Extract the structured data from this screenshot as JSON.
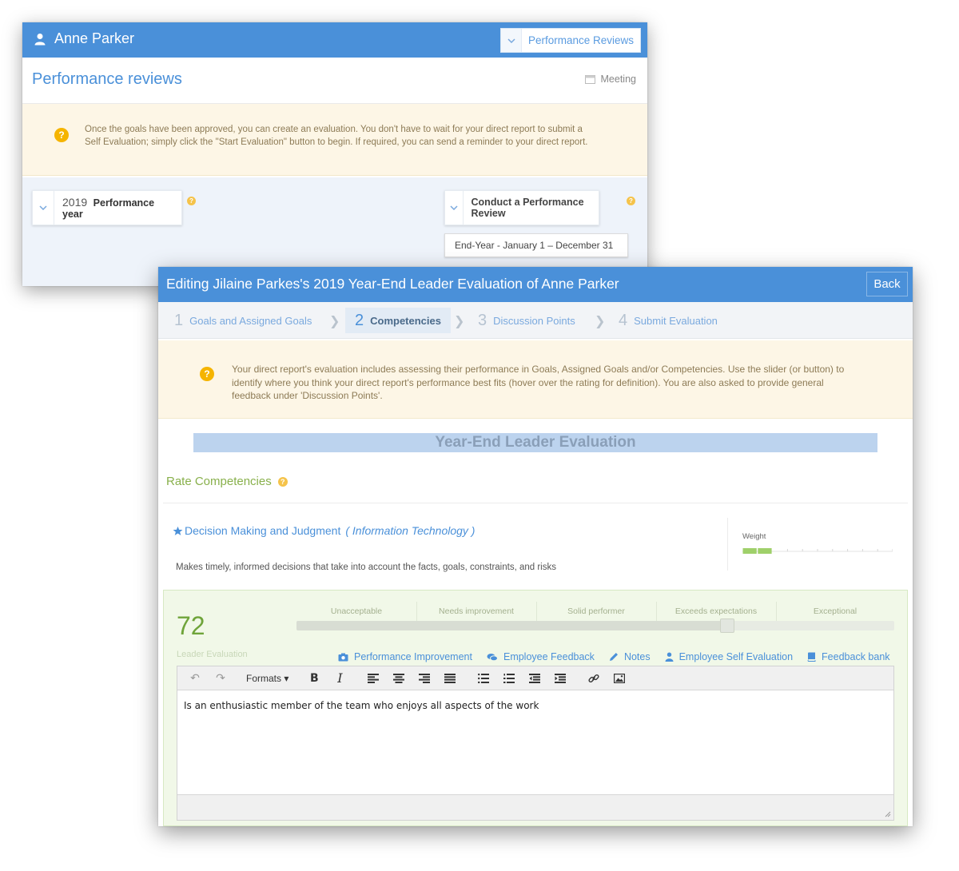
{
  "back_window": {
    "user_name": "Anne Parker",
    "module_select": "Performance Reviews",
    "title": "Performance reviews",
    "meeting_label": "Meeting",
    "alert_text": "Once the goals have been approved, you can create an evaluation. You don't have to wait for your direct report to submit a Self Evaluation; simply click the \"Start Evaluation\" button to begin. If required, you can send a reminder to your direct report.",
    "year_value": "2019",
    "year_label": "Performance year",
    "conduct_label": "Conduct a Performance Review",
    "period": "End-Year - January 1 – December 31"
  },
  "front_window": {
    "title": "Editing Jilaine Parkes's 2019 Year-End Leader Evaluation of Anne Parker",
    "back_label": "Back",
    "steps": [
      {
        "num": "1",
        "label": "Goals and Assigned Goals"
      },
      {
        "num": "2",
        "label": "Competencies"
      },
      {
        "num": "3",
        "label": "Discussion Points"
      },
      {
        "num": "4",
        "label": "Submit Evaluation"
      }
    ],
    "alert_text": "Your direct report's evaluation includes assessing their performance in Goals, Assigned Goals and/or Competencies. Use the slider (or button) to identify where you think your direct report's performance best fits (hover over the rating for definition). You are also asked to provide general feedback under 'Discussion Points'.",
    "banner": "Year-End Leader Evaluation",
    "rate_title": "Rate Competencies",
    "competency": {
      "name": "Decision Making and Judgment",
      "category": "( Information Technology )",
      "description": "Makes timely, informed decisions that take into account the facts, goals, constraints, and risks",
      "weight_label": "Weight",
      "weight_fraction": 0.2
    },
    "rating": {
      "score": "72",
      "score_label": "Leader Evaluation",
      "slider_fraction": 0.72,
      "scale": [
        "Unacceptable",
        "Needs improvement",
        "Solid performer",
        "Exceeds expectations",
        "Exceptional"
      ]
    },
    "links": [
      {
        "icon": "camera-icon",
        "label": "Performance Improvement"
      },
      {
        "icon": "comments-icon",
        "label": "Employee Feedback"
      },
      {
        "icon": "pencil-icon",
        "label": "Notes"
      },
      {
        "icon": "user-icon",
        "label": "Employee Self Evaluation"
      },
      {
        "icon": "book-icon",
        "label": "Feedback bank"
      }
    ],
    "editor": {
      "formats_label": "Formats ▾",
      "content": "Is an enthusiastic member of the team who enjoys all aspects of the work"
    }
  },
  "colors": {
    "header_blue": "#4a90d9",
    "alert_bg": "#fdf6e6",
    "help_orange": "#f5b400",
    "score_green": "#6fa43a",
    "panel_green": "#f1f8e8"
  }
}
